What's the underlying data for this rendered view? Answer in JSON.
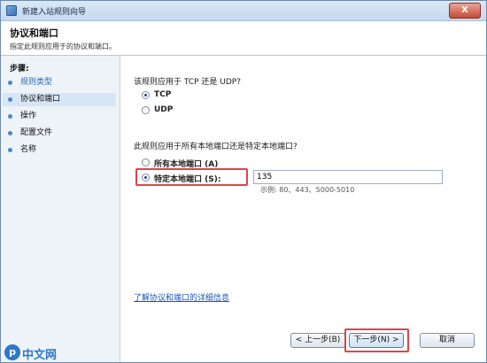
{
  "window": {
    "title": "新建入站规则向导",
    "close_label": "X"
  },
  "header": {
    "title": "协议和端口",
    "subtitle": "指定此规则应用于的协议和端口。"
  },
  "steps": {
    "heading": "步骤:",
    "items": [
      {
        "label": "规则类型",
        "state": "done"
      },
      {
        "label": "协议和端口",
        "state": "active"
      },
      {
        "label": "操作",
        "state": "pending"
      },
      {
        "label": "配置文件",
        "state": "pending"
      },
      {
        "label": "名称",
        "state": "pending"
      }
    ]
  },
  "protocol": {
    "question": "该规则应用于 TCP 还是 UDP?",
    "options": [
      {
        "label": "TCP",
        "checked": true
      },
      {
        "label": "UDP",
        "checked": false
      }
    ]
  },
  "ports": {
    "question": "此规则应用于所有本地端口还是特定本地端口?",
    "options": [
      {
        "label": "所有本地端口 (A)",
        "checked": false
      },
      {
        "label": "特定本地端口 (S):",
        "checked": true
      }
    ],
    "value": "135",
    "example": "示例: 80、443、5000-5010"
  },
  "link": "了解协议和端口的详细信息",
  "buttons": {
    "back": "< 上一步(B)",
    "next": "下一步(N) >",
    "cancel": "取消"
  },
  "watermark": {
    "logo_letter": "p",
    "text": "中文网"
  },
  "colors": {
    "highlight": "#d9474b",
    "link": "#1c56b5",
    "accent": "#4b86c8"
  }
}
